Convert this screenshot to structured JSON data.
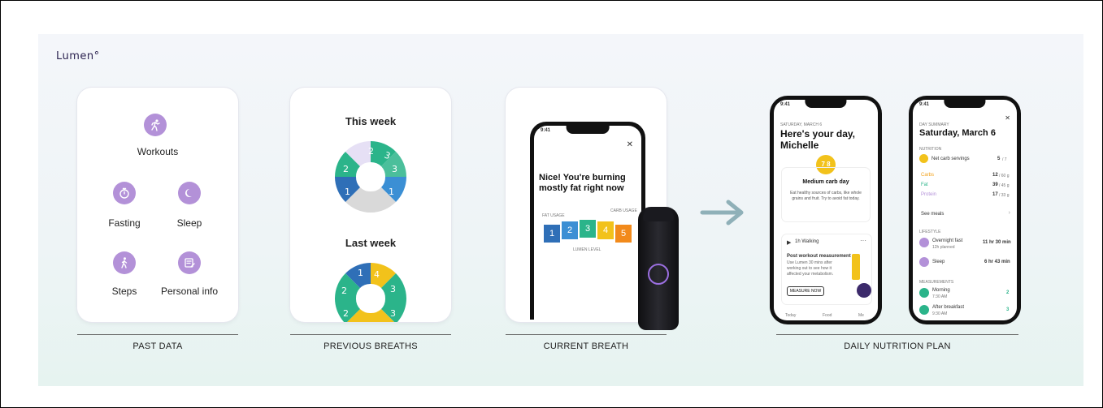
{
  "brand": {
    "logo_text": "Lumen°"
  },
  "sections": [
    {
      "caption": "PAST DATA"
    },
    {
      "caption": "PREVIOUS BREATHS"
    },
    {
      "caption": "CURRENT BREATH"
    },
    {
      "caption": "DAILY NUTRITION PLAN"
    }
  ],
  "past_data": {
    "items": [
      {
        "label": "Workouts",
        "icon": "running-icon"
      },
      {
        "label": "Fasting",
        "icon": "stopwatch-icon"
      },
      {
        "label": "Sleep",
        "icon": "moon-icon"
      },
      {
        "label": "Steps",
        "icon": "walking-icon"
      },
      {
        "label": "Personal info",
        "icon": "profile-card-icon"
      }
    ],
    "accent": "#b391d8"
  },
  "previous_breaths": {
    "this_week": "This week",
    "last_week": "Last week",
    "colors": {
      "fat_dark": "#2f6fb7",
      "fat_light": "#3b8fd4",
      "mid": "#2bb48a",
      "carb": "#f2c21b",
      "grey": "#d9d9d9",
      "lavender": "#e6e0f5"
    }
  },
  "current_breath": {
    "time": "9:41",
    "message": "Nice! You're burning mostly fat right now",
    "left_scale": "FAT USAGE",
    "right_scale": "CARB USAGE",
    "bottom_scale": "LUMEN LEVEL",
    "levels": [
      "1",
      "2",
      "3",
      "4",
      "5"
    ]
  },
  "phone_today": {
    "time": "9:41",
    "date": "SATURDAY, MARCH 6",
    "greeting": "Here's your day, Michelle",
    "score": "7 8",
    "day_type": "Medium carb day",
    "description": "Eat healthy sources of carbs, like whole grains and fruit. Try to avoid fat today.",
    "activity": "1h Walking",
    "workout_title": "Post workout measurement",
    "workout_desc": "Use Lumen 30 mins after working out to see how it affected your metabolism.",
    "measure_button": "MEASURE NOW",
    "nav": [
      "Today",
      "Food",
      "Me"
    ]
  },
  "phone_summary": {
    "time": "9:41",
    "kicker": "DAY SUMMARY",
    "date": "Saturday, March 6",
    "nutrition_label": "NUTRITION",
    "rows": [
      {
        "label": "Net carb servings",
        "value": "5",
        "unit": "/ 7"
      },
      {
        "label": "Carbs",
        "value": "12",
        "unit": "/ 60 g"
      },
      {
        "label": "Fat",
        "value": "39",
        "unit": "/ 45 g"
      },
      {
        "label": "Protein",
        "value": "17",
        "unit": "/ 33 g"
      }
    ],
    "see_meals": "See meals",
    "lifestyle_label": "LIFESTYLE",
    "lifestyle": [
      {
        "label": "Overnight fast",
        "sub": "12h planned",
        "value": "11 hr 30 min"
      },
      {
        "label": "Sleep",
        "sub": "",
        "value": "6 hr 43 min"
      }
    ],
    "measurements_label": "MEASUREMENTS",
    "measurements": [
      {
        "label": "Morning",
        "sub": "7:30 AM",
        "value": "2"
      },
      {
        "label": "After breakfast",
        "sub": "9:30 AM",
        "value": "3"
      }
    ]
  }
}
